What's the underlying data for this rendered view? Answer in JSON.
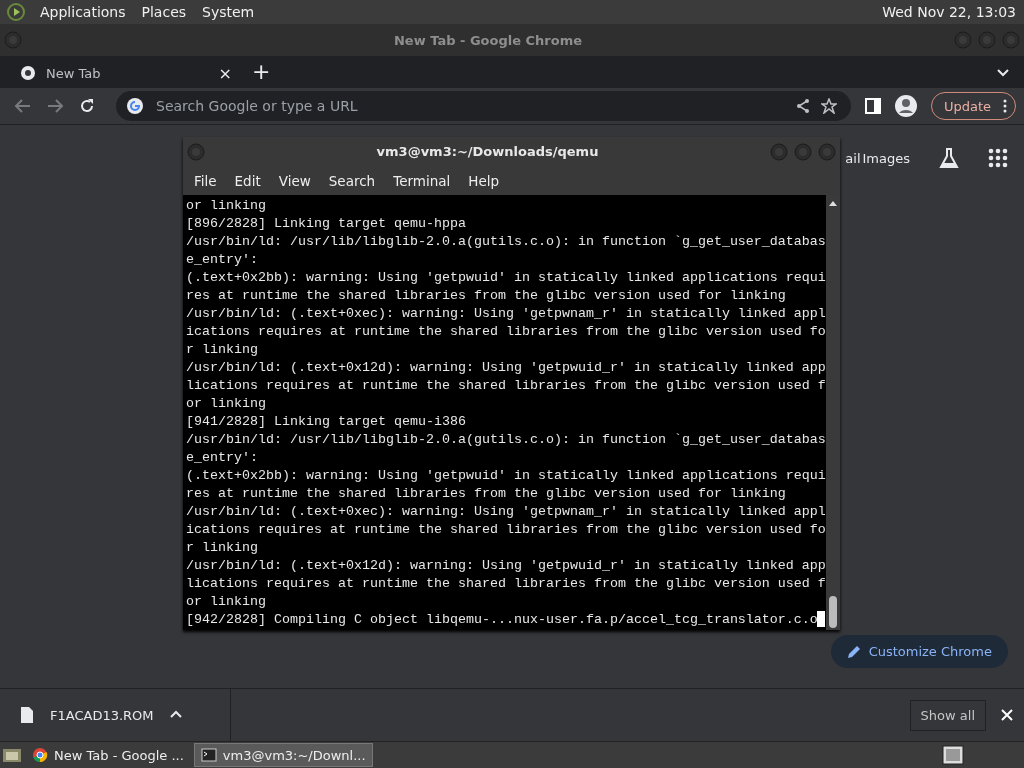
{
  "top_panel": {
    "menus": [
      "Applications",
      "Places",
      "System"
    ],
    "clock": "Wed Nov 22, 13:03"
  },
  "browser": {
    "title": "New Tab - Google Chrome",
    "tabs": [
      {
        "label": "New Tab",
        "selected": true
      }
    ],
    "close_tab": "×",
    "new_tab": "+",
    "address": {
      "placeholder": "Search Google or type a URL"
    },
    "update_button": "Update",
    "links": [
      "ail",
      "Images"
    ],
    "customize_button": "Customize Chrome",
    "download": {
      "file": "F1ACAD13.ROM",
      "show_all": "Show all"
    }
  },
  "terminal": {
    "title": "vm3@vm3:~/Downloads/qemu",
    "menus": [
      "File",
      "Edit",
      "View",
      "Search",
      "Terminal",
      "Help"
    ],
    "lines": [
      "or linking",
      "[896/2828] Linking target qemu-hppa",
      "/usr/bin/ld: /usr/lib/libglib-2.0.a(gutils.c.o): in function `g_get_user_databas",
      "e_entry':",
      "(.text+0x2bb): warning: Using 'getpwuid' in statically linked applications requi",
      "res at runtime the shared libraries from the glibc version used for linking",
      "/usr/bin/ld: (.text+0xec): warning: Using 'getpwnam_r' in statically linked appl",
      "ications requires at runtime the shared libraries from the glibc version used fo",
      "r linking",
      "/usr/bin/ld: (.text+0x12d): warning: Using 'getpwuid_r' in statically linked app",
      "lications requires at runtime the shared libraries from the glibc version used f",
      "or linking",
      "[941/2828] Linking target qemu-i386",
      "/usr/bin/ld: /usr/lib/libglib-2.0.a(gutils.c.o): in function `g_get_user_databas",
      "e_entry':",
      "(.text+0x2bb): warning: Using 'getpwuid' in statically linked applications requi",
      "res at runtime the shared libraries from the glibc version used for linking",
      "/usr/bin/ld: (.text+0xec): warning: Using 'getpwnam_r' in statically linked appl",
      "ications requires at runtime the shared libraries from the glibc version used fo",
      "r linking",
      "/usr/bin/ld: (.text+0x12d): warning: Using 'getpwuid_r' in statically linked app",
      "lications requires at runtime the shared libraries from the glibc version used f",
      "or linking",
      "[942/2828] Compiling C object libqemu-...nux-user.fa.p/accel_tcg_translator.c.o"
    ]
  },
  "taskbar": {
    "tasks": [
      {
        "label": "New Tab - Google ...",
        "selected": false
      },
      {
        "label": "vm3@vm3:~/Downl...",
        "selected": true
      }
    ]
  }
}
